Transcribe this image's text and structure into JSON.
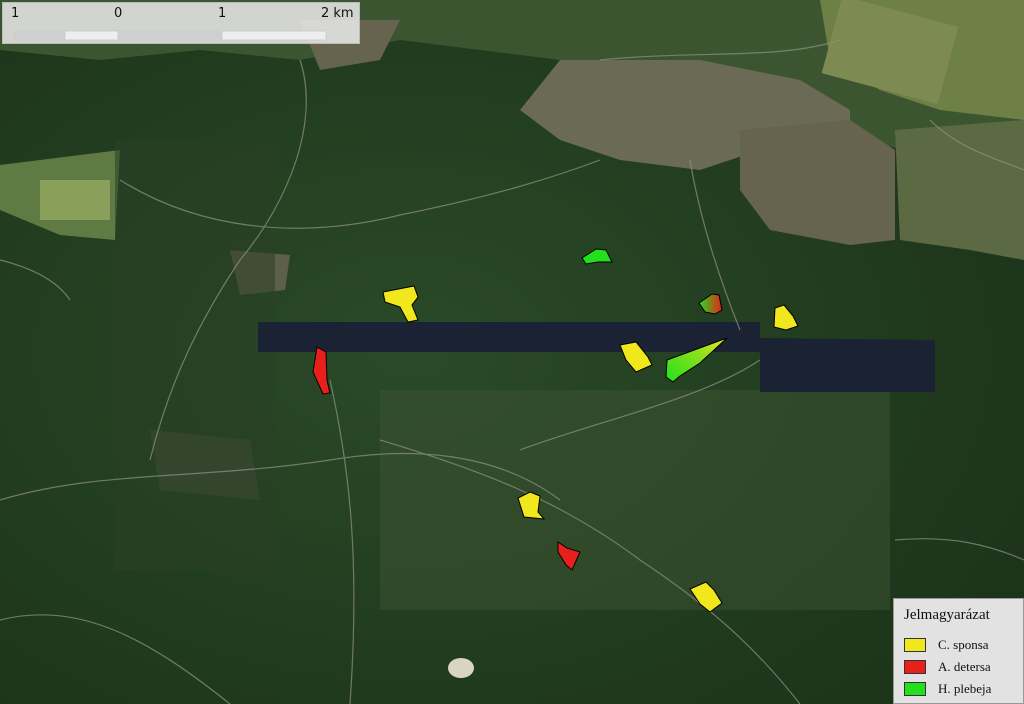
{
  "scalebar": {
    "labels": [
      "1",
      "0",
      "1",
      "2 km"
    ]
  },
  "legend": {
    "title": "Jelmagyarázat",
    "items": [
      {
        "label": "C. sponsa",
        "color": "#f0e81c"
      },
      {
        "label": "A. detersa",
        "color": "#e8201c"
      },
      {
        "label": "H. plebeja",
        "color": "#22e01c"
      }
    ]
  },
  "colors": {
    "forest": "#233f22",
    "town": "#6b6a55",
    "field": "#6f8046",
    "nodata_strip": "#1b2233",
    "outline": "#000000"
  }
}
